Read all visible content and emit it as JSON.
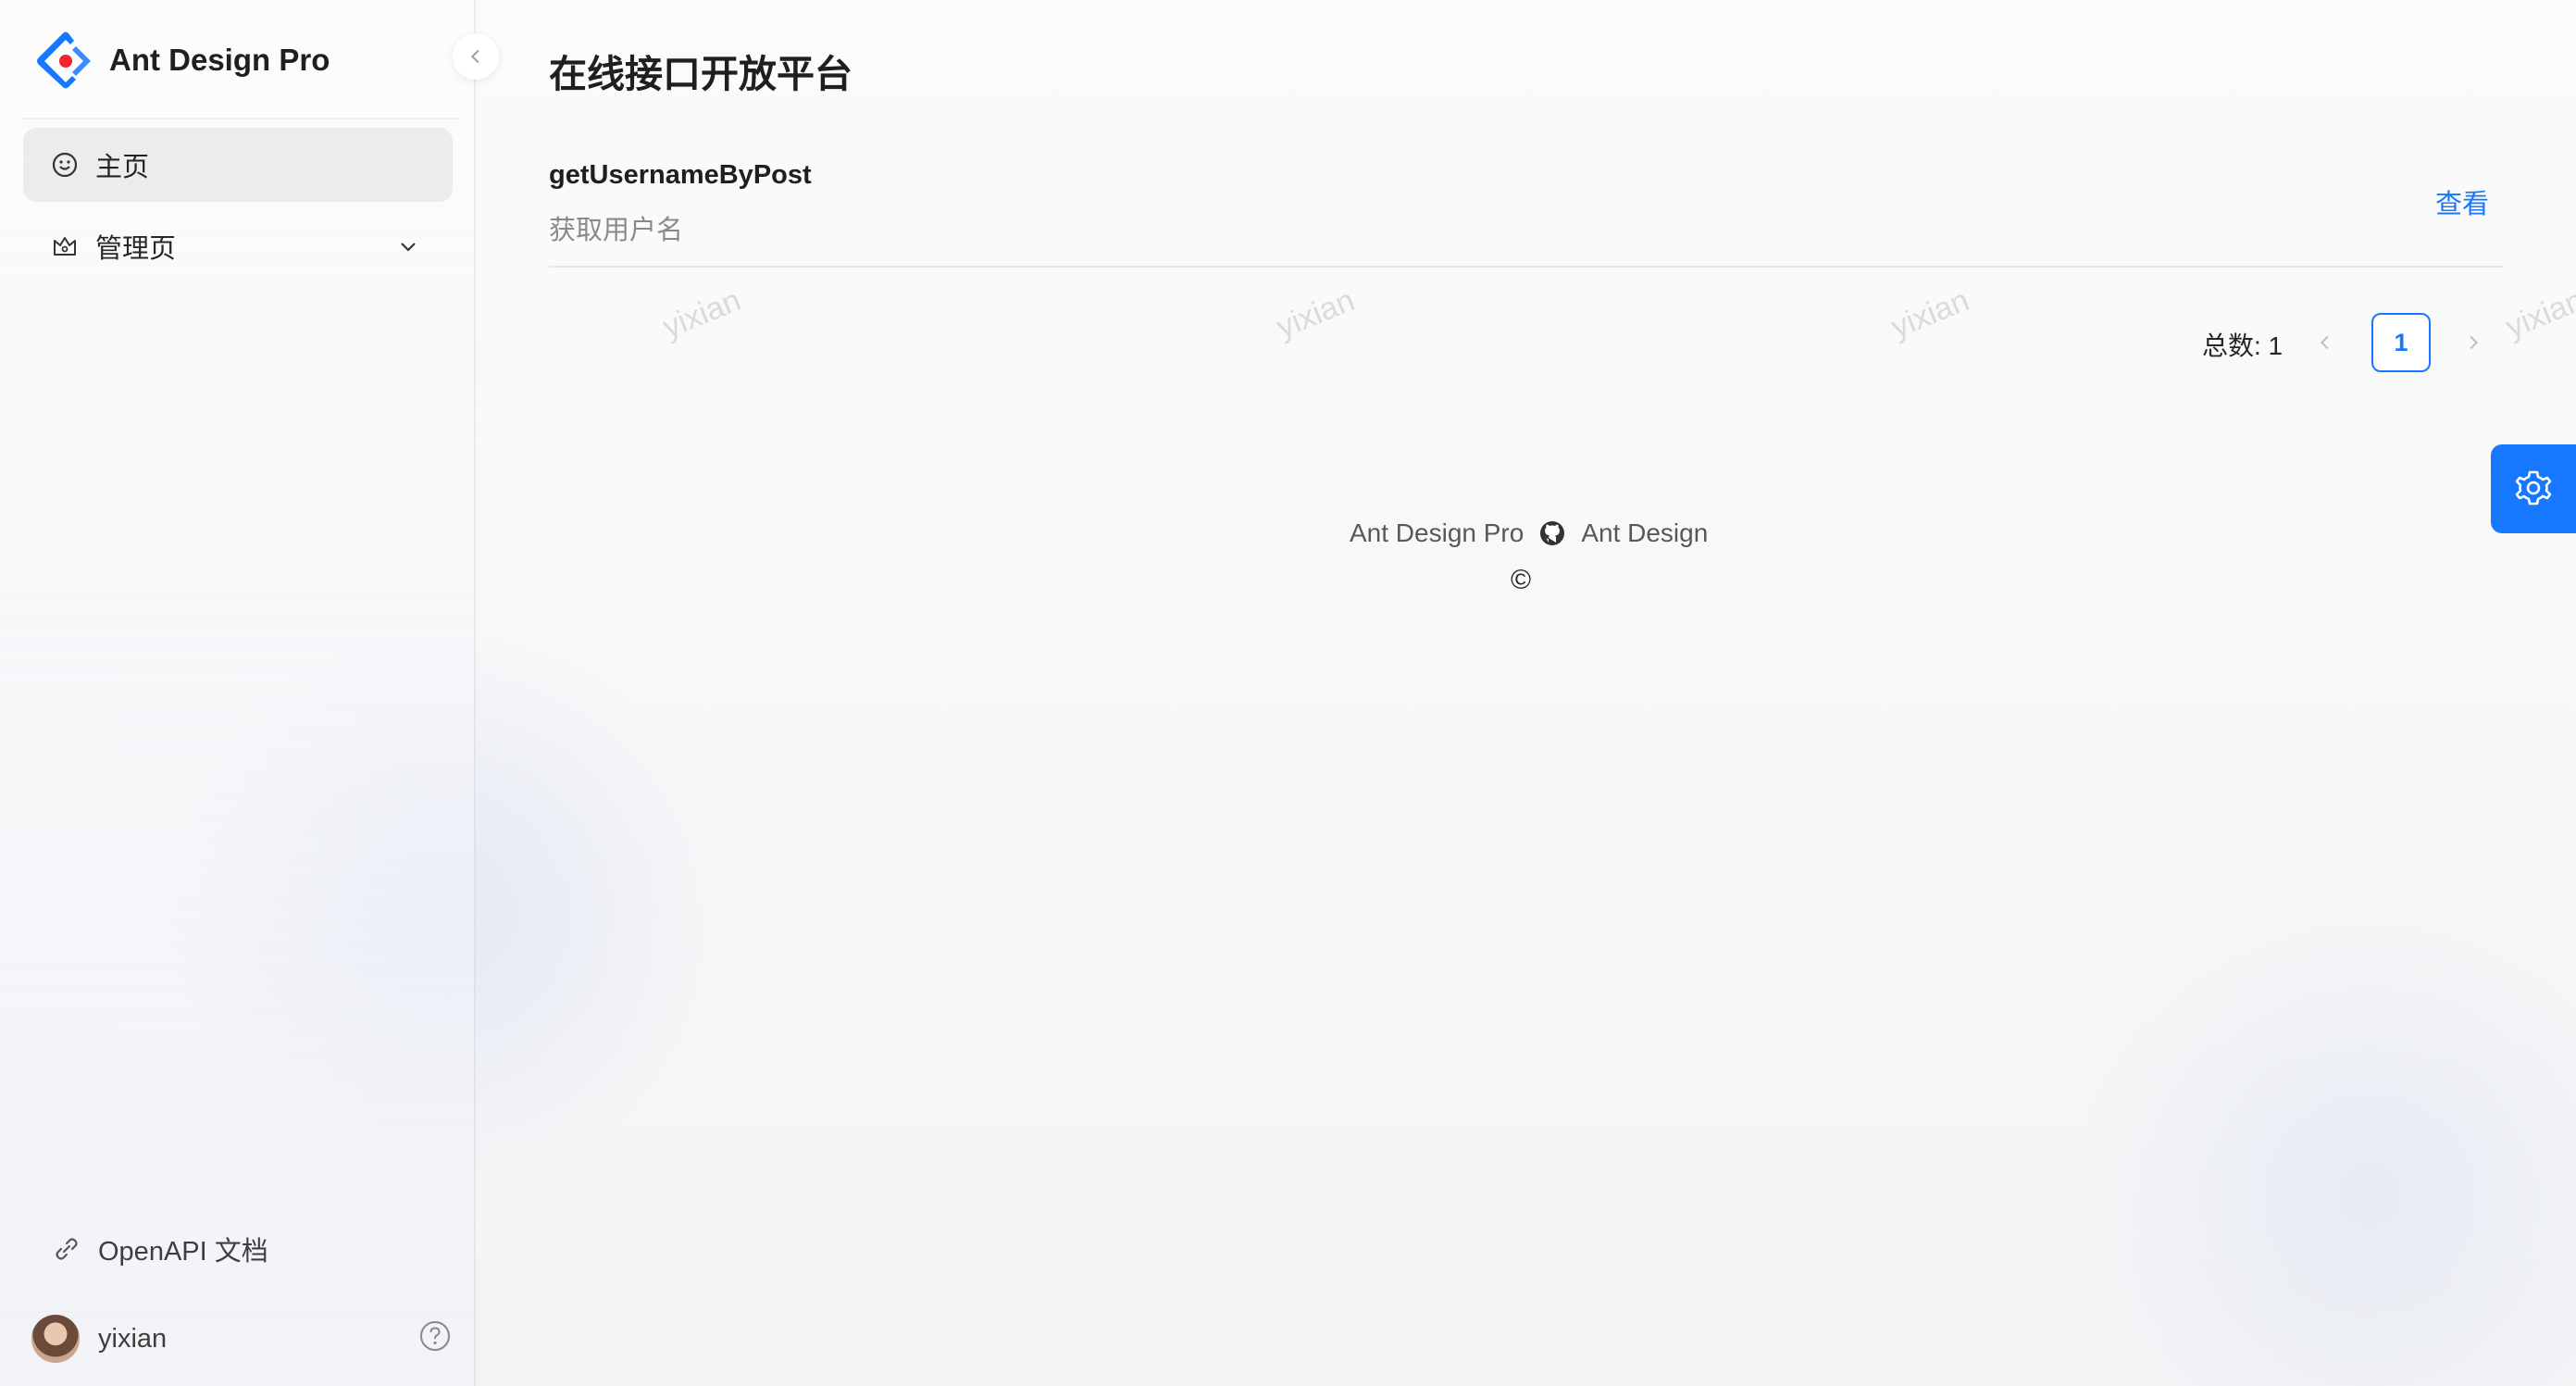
{
  "app": {
    "title": "Ant Design Pro"
  },
  "sidebar": {
    "items": [
      {
        "label": "主页",
        "icon": "smile-icon",
        "active": true
      },
      {
        "label": "管理页",
        "icon": "crown-icon",
        "active": false
      }
    ],
    "openapi_label": "OpenAPI 文档",
    "user": {
      "name": "yixian"
    }
  },
  "main": {
    "title": "在线接口开放平台",
    "list": [
      {
        "name": "getUsernameByPost",
        "description": "获取用户名",
        "action": "查看"
      }
    ],
    "pagination": {
      "total_label": "总数: 1",
      "current_page": "1"
    }
  },
  "footer": {
    "left_link": "Ant Design Pro",
    "right_link": "Ant Design",
    "copyright": "©"
  },
  "watermark": "yixian",
  "colors": {
    "primary": "#1677ff"
  }
}
